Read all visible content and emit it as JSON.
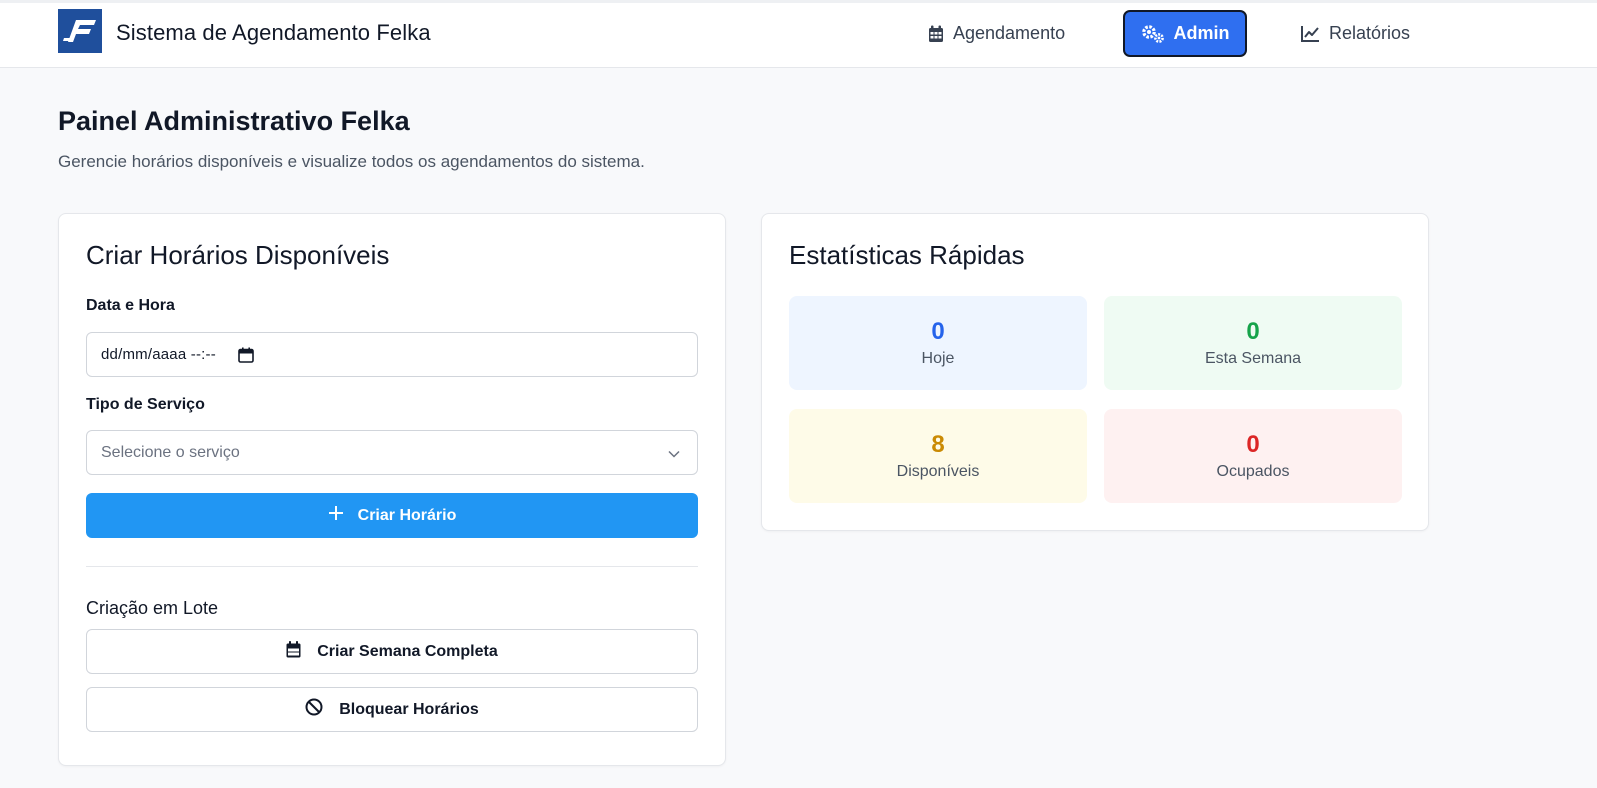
{
  "header": {
    "title": "Sistema de Agendamento Felka",
    "nav": {
      "agendamento": "Agendamento",
      "admin": "Admin",
      "relatorios": "Relatórios"
    },
    "active_nav": "admin",
    "accent_color": "#2f6ff0"
  },
  "page": {
    "title": "Painel Administrativo Felka",
    "subtitle": "Gerencie horários disponíveis e visualize todos os agendamentos do sistema."
  },
  "create_card": {
    "title": "Criar Horários Disponíveis",
    "datetime": {
      "label": "Data e Hora",
      "placeholder": "dd/mm/aaaa --:--"
    },
    "service": {
      "label": "Tipo de Serviço",
      "placeholder": "Selecione o serviço"
    },
    "create_button": "Criar Horário",
    "batch": {
      "title": "Criação em Lote",
      "week_button": "Criar Semana Completa",
      "block_button": "Bloquear Horários"
    }
  },
  "stats_card": {
    "title": "Estatísticas Rápidas",
    "today": {
      "value": "0",
      "label": "Hoje",
      "color": "#2563eb"
    },
    "week": {
      "value": "0",
      "label": "Esta Semana",
      "color": "#16a34a"
    },
    "available": {
      "value": "8",
      "label": "Disponíveis",
      "color": "#ca8a04"
    },
    "busy": {
      "value": "0",
      "label": "Ocupados",
      "color": "#dc2626"
    }
  },
  "icons": {
    "logo": "felka-logo",
    "agendamento": "calendar-icon",
    "admin": "cogs-icon",
    "relatorios": "line-chart-icon",
    "datetime": "calendar-picker-icon",
    "service": "chevron-down-icon",
    "create": "plus-icon",
    "week": "calendar-icon",
    "block": "ban-icon"
  }
}
